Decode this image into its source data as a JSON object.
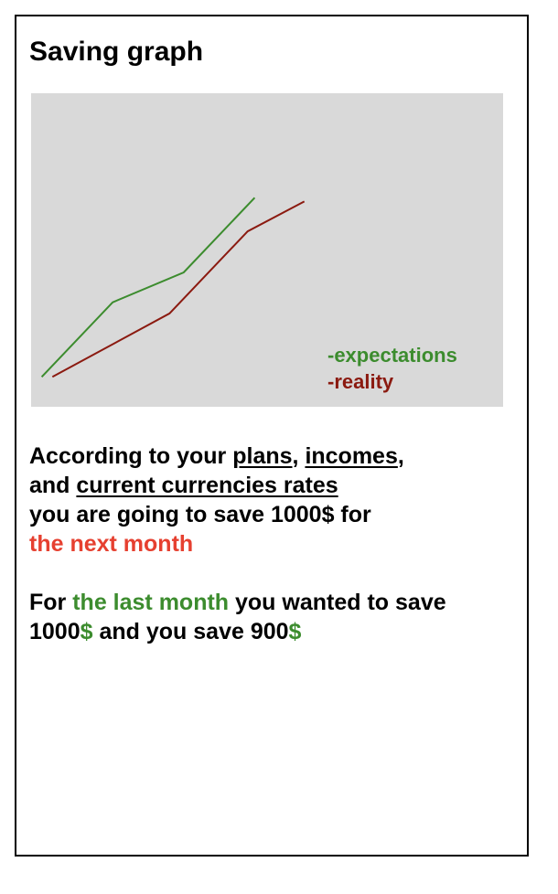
{
  "page": {
    "title": "Saving graph"
  },
  "chart_data": {
    "type": "line",
    "title": "",
    "xlabel": "",
    "ylabel": "",
    "grid": false,
    "legend_placement": "bottom-right",
    "series": [
      {
        "name": "-expectations",
        "color": "#3c8c2e",
        "points": [
          [
            0,
            0
          ],
          [
            1,
            1
          ],
          [
            2,
            1.4
          ],
          [
            3,
            2.4
          ]
        ]
      },
      {
        "name": "-reality",
        "color": "#8b1a10",
        "points": [
          [
            0.15,
            0
          ],
          [
            1.8,
            0.85
          ],
          [
            2.9,
            1.95
          ],
          [
            3.7,
            2.35
          ]
        ]
      }
    ],
    "xlim": [
      -0.15,
      6.5
    ],
    "ylim": [
      -0.4,
      3.8
    ]
  },
  "summary": {
    "p1_part1": "According to your ",
    "link_plans": "plans",
    "sep1": ", ",
    "link_incomes": "incomes",
    "sep2": ",",
    "p1_and": "and ",
    "link_rates": "current currencies rates",
    "p1_line3": "you are going to save 1000$ for",
    "p1_highlight": "the next month"
  },
  "last_month": {
    "p2_part1": "For ",
    "p2_highlight": "the last month",
    "p2_part2": " you wanted to save",
    "p2_value1": "1000",
    "currency1": "$",
    "p2_part3": " and you save 900",
    "currency2": "$"
  },
  "colors": {
    "accent_red": "#e64030",
    "accent_green": "#3c8c2e",
    "chart_bg": "#d9d9d9"
  }
}
